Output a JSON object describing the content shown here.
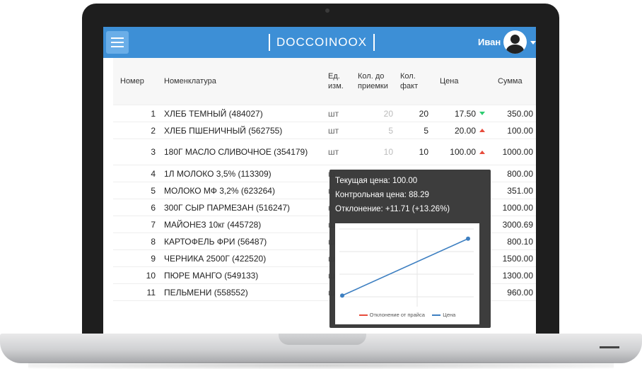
{
  "header": {
    "logo_text": "DOCCOINOOX",
    "user_name": "Иван",
    "accent_color": "#3d8fd6"
  },
  "table": {
    "columns": {
      "num": "Номер",
      "name": "Номенклатура",
      "unit": "Ед. изм.",
      "qty_expected": "Кол. до приемки",
      "qty_fact": "Кол. факт",
      "price": "Цена",
      "sum": "Сумма"
    },
    "rows": [
      {
        "num": "1",
        "name": "ХЛЕБ ТЕМНЫЙ (484027)",
        "unit": "шт",
        "qty_expected": "20",
        "qty_fact": "20",
        "price": "17.50",
        "trend": "down",
        "sum": "350.00"
      },
      {
        "num": "2",
        "name": "ХЛЕБ ПШЕНИЧНЫЙ (562755)",
        "unit": "шт",
        "qty_expected": "5",
        "qty_fact": "5",
        "price": "20.00",
        "trend": "up",
        "sum": "100.00"
      },
      {
        "num": "3",
        "name": "180Г МАСЛО СЛИВОЧНОЕ (354179)",
        "unit": "шт",
        "qty_expected": "10",
        "qty_fact": "10",
        "price": "100.00",
        "trend": "up",
        "sum": "1000.00"
      },
      {
        "num": "4",
        "name": "1Л МОЛОКО 3,5% (113309)",
        "unit": "ш",
        "sum": "800.00"
      },
      {
        "num": "5",
        "name": "МОЛОКО МФ 3,2% (623264)",
        "unit": "ш",
        "sum": "351.00"
      },
      {
        "num": "6",
        "name": "300Г СЫР ПАРМЕЗАН (516247)",
        "unit": "к",
        "sum": "1000.00"
      },
      {
        "num": "7",
        "name": "МАЙОНЕЗ 10кг (445728)",
        "unit": "ш",
        "sum": "3000.69"
      },
      {
        "num": "8",
        "name": "КАРТОФЕЛЬ ФРИ (56487)",
        "unit": "ш",
        "sum": "800.10"
      },
      {
        "num": "9",
        "name": "ЧЕРНИКА 2500Г (422520)",
        "unit": "ш",
        "sum": "1500.00"
      },
      {
        "num": "10",
        "name": "ПЮРЕ МАНГО (549133)",
        "unit": "ш",
        "sum": "1300.00"
      },
      {
        "num": "11",
        "name": "ПЕЛЬМЕНИ (558552)",
        "unit": "ш",
        "sum": "960.00"
      }
    ]
  },
  "tooltip": {
    "current_price": "Текущая цена: 100.00",
    "control_price": "Контрольная цена: 88.29",
    "deviation": "Отклонение: +11.71 (+13.26%)",
    "legend_deviation": "Отклонение от прайса",
    "legend_price": "Цена",
    "deviation_color": "#e74c3c",
    "price_color": "#3d7fc1"
  },
  "chart_data": {
    "type": "line",
    "series": [
      {
        "name": "Цена",
        "values": [
          88.29,
          100.0
        ]
      },
      {
        "name": "Отклонение от прайса",
        "values": []
      }
    ]
  }
}
